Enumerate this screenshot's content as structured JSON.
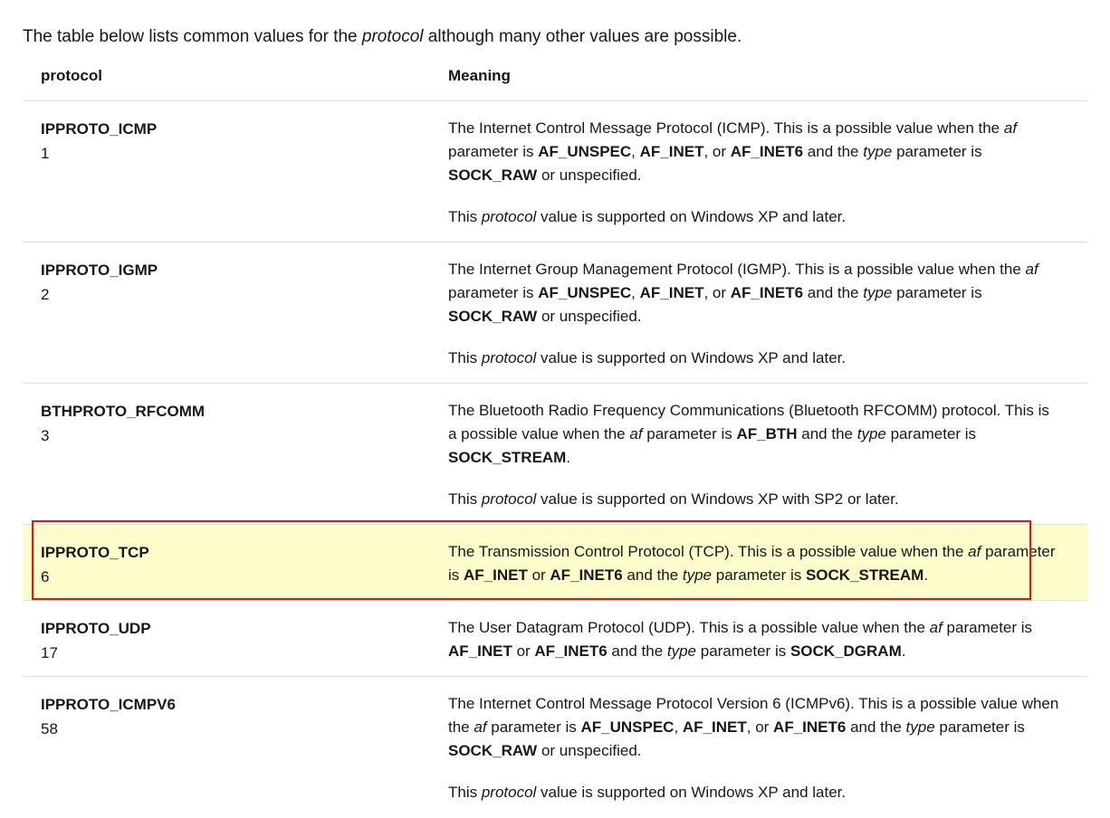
{
  "intro": {
    "before": "The table below lists common values for the ",
    "term": "protocol",
    "after": " although many other values are possible."
  },
  "table": {
    "headers": [
      "protocol",
      "Meaning"
    ],
    "rows": [
      {
        "name": "IPPROTO_ICMP",
        "value": "1",
        "meaning": "The Internet Control Message Protocol (ICMP). This is a possible value when the af parameter is AF_UNSPEC, AF_INET, or AF_INET6 and the type parameter is SOCK_RAW or unspecified.",
        "support": "This protocol value is supported on Windows XP and later."
      },
      {
        "name": "IPPROTO_IGMP",
        "value": "2",
        "meaning": "The Internet Group Management Protocol (IGMP). This is a possible value when the af parameter is AF_UNSPEC, AF_INET, or AF_INET6 and the type parameter is SOCK_RAW or unspecified.",
        "support": "This protocol value is supported on Windows XP and later."
      },
      {
        "name": "BTHPROTO_RFCOMM",
        "value": "3",
        "meaning": "The Bluetooth Radio Frequency Communications (Bluetooth RFCOMM) protocol. This is a possible value when the af parameter is AF_BTH and the type parameter is SOCK_STREAM.",
        "support": "This protocol value is supported on Windows XP with SP2 or later."
      },
      {
        "name": "IPPROTO_TCP",
        "value": "6",
        "meaning": "The Transmission Control Protocol (TCP). This is a possible value when the af parameter is AF_INET or AF_INET6 and the type parameter is SOCK_STREAM.",
        "highlighted": true
      },
      {
        "name": "IPPROTO_UDP",
        "value": "17",
        "meaning": "The User Datagram Protocol (UDP). This is a possible value when the af parameter is AF_INET or AF_INET6 and the type parameter is SOCK_DGRAM."
      },
      {
        "name": "IPPROTO_ICMPV6",
        "value": "58",
        "meaning": "The Internet Control Message Protocol Version 6 (ICMPv6). This is a possible value when the af parameter is AF_UNSPEC, AF_INET, or AF_INET6 and the type parameter is SOCK_RAW or unspecified.",
        "support": "This protocol value is supported on Windows XP and later."
      }
    ]
  },
  "formatting": {
    "bold_terms": [
      "AF_UNSPEC",
      "AF_INET6",
      "AF_INET",
      "AF_BTH",
      "SOCK_STREAM",
      "SOCK_DGRAM",
      "SOCK_RAW"
    ],
    "italic_terms": [
      "protocol",
      "type",
      "af"
    ]
  },
  "colors": {
    "highlight_fill": "#fdfdcc",
    "highlight_border": "#d21c1c",
    "row_divider": "#e1e1e1"
  }
}
